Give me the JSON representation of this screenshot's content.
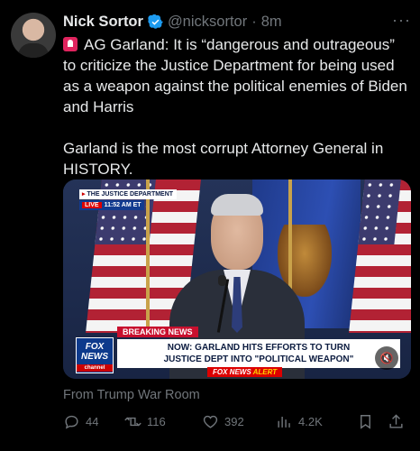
{
  "author": {
    "name": "Nick Sortor",
    "handle": "@nicksortor",
    "separator": "·",
    "time": "8m",
    "verified": true,
    "avatar_icon": "avatar"
  },
  "more_label": "···",
  "tweet": {
    "text": "AG Garland: It is “dangerous and outrageous” to criticize the Justice Department for being used as a weapon against the political enemies of Biden and Harris\n\nGarland is the most corrupt Attorney General in HISTORY.",
    "emoji_icon": "siren-icon"
  },
  "video": {
    "chyron_top_line1": "THE JUSTICE DEPARTMENT",
    "chyron_live": "LIVE",
    "chyron_time": "11:52 AM ET",
    "breaking_label": "BREAKING NEWS",
    "headline_line1": "NOW: GARLAND HITS EFFORTS TO TURN",
    "headline_line2": "JUSTICE DEPT INTO \"POLITICAL WEAPON\"",
    "alert_prefix": "FOX NEWS",
    "alert_suffix": "ALERT",
    "logo_line1": "FOX",
    "logo_line2": "NEWS",
    "logo_line3": "channel",
    "mute_icon": "mute-icon"
  },
  "source_text": "From Trump War Room",
  "actions": {
    "replies": "44",
    "reposts": "116",
    "likes": "392",
    "views": "4.2K"
  },
  "colors": {
    "background": "#000000",
    "text": "#e7e9ea",
    "muted": "#71767b",
    "verified": "#1d9bf0"
  }
}
